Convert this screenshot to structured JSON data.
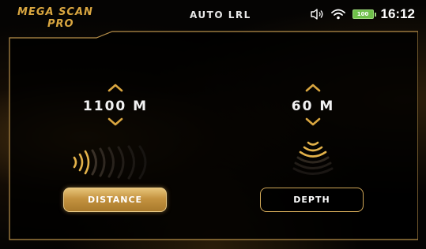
{
  "status_bar": {
    "brand_line1": "MEGA SCAN",
    "brand_line2": "PRO",
    "mode_title": "AUTO LRL",
    "battery_level": "100",
    "time": "16:12",
    "icons": [
      "volume-icon",
      "wifi-icon",
      "battery-icon"
    ]
  },
  "distance": {
    "value": "1100 M",
    "button_label": "DISTANCE",
    "selected": true
  },
  "depth": {
    "value": "60 M",
    "button_label": "DEPTH",
    "selected": false
  },
  "colors": {
    "gold": "#cfa657",
    "brand": "#d9a640",
    "battery": "#6fc04a",
    "background": "#050403"
  }
}
